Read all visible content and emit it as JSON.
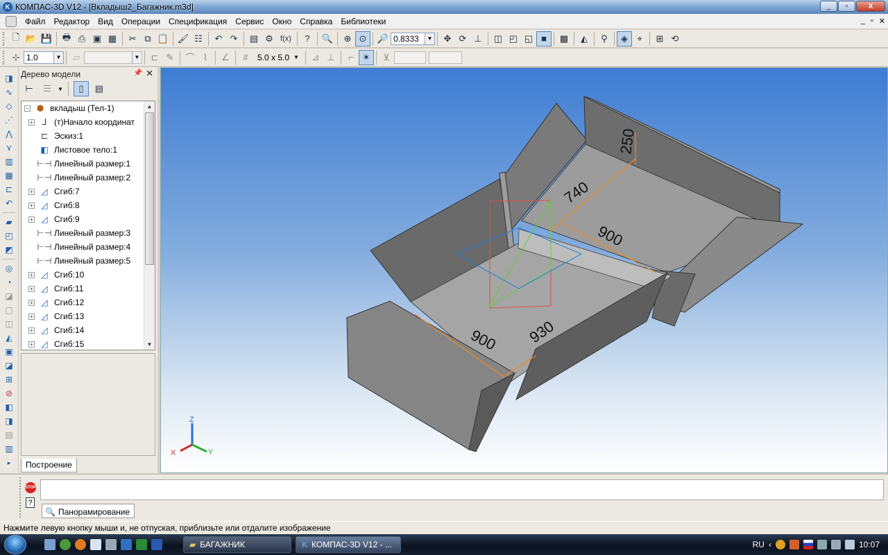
{
  "window": {
    "title": "КОМПАС-3D V12 - [Вкладыш2_Багажник.m3d]",
    "min_label": "_",
    "max_label": "▫",
    "close_label": "X"
  },
  "menu": {
    "items": [
      {
        "label": "Файл"
      },
      {
        "label": "Редактор"
      },
      {
        "label": "Вид"
      },
      {
        "label": "Операции"
      },
      {
        "label": "Спецификация"
      },
      {
        "label": "Сервис"
      },
      {
        "label": "Окно"
      },
      {
        "label": "Справка"
      },
      {
        "label": "Библиотеки"
      }
    ]
  },
  "toolbar1": {
    "zoom_value": "0.8333",
    "fx_label": "f(x)"
  },
  "toolbar2": {
    "step_value": "1.0",
    "grid_value": "5.0 x 5.0"
  },
  "tree": {
    "title": "Дерево модели",
    "rows": [
      {
        "label": "вкладыш (Тел-1)",
        "icon": "part-icon"
      },
      {
        "label": "(т)Начало координат",
        "icon": "origin-icon"
      },
      {
        "label": "Эскиз:1",
        "icon": "sketch-icon"
      },
      {
        "label": "Листовое тело:1",
        "icon": "sheet-body-icon"
      },
      {
        "label": "Линейный размер:1",
        "icon": "dimension-icon"
      },
      {
        "label": "Линейный размер:2",
        "icon": "dimension-icon"
      },
      {
        "label": "Сгиб:7",
        "icon": "bend-icon"
      },
      {
        "label": "Сгиб:8",
        "icon": "bend-icon"
      },
      {
        "label": "Сгиб:9",
        "icon": "bend-icon"
      },
      {
        "label": "Линейный размер:3",
        "icon": "dimension-icon"
      },
      {
        "label": "Линейный размер:4",
        "icon": "dimension-icon"
      },
      {
        "label": "Линейный размер:5",
        "icon": "dimension-icon"
      },
      {
        "label": "Сгиб:10",
        "icon": "bend-icon"
      },
      {
        "label": "Сгиб:11",
        "icon": "bend-icon"
      },
      {
        "label": "Сгиб:12",
        "icon": "bend-icon"
      },
      {
        "label": "Сгиб:13",
        "icon": "bend-icon"
      },
      {
        "label": "Сгиб:14",
        "icon": "bend-icon"
      },
      {
        "label": "Сгиб:15",
        "icon": "bend-icon"
      }
    ],
    "tab_label": "Построение"
  },
  "model": {
    "dimensions": [
      "250",
      "740",
      "900",
      "900",
      "930"
    ],
    "axes": {
      "x": "X",
      "y": "Y",
      "z": "Z"
    }
  },
  "properties": {
    "stop_label": "STOP",
    "help_label": "?",
    "tab_label": "Панорамирование"
  },
  "status": {
    "text": "Нажмите левую кнопку мыши и, не отпуская, приблизьте или отдалите изображение"
  },
  "taskbar": {
    "tasks": [
      {
        "label": "БАГАЖНИК"
      },
      {
        "label": "КОМПАС-3D V12 - ..."
      }
    ],
    "lang": "RU",
    "clock": "10:07"
  },
  "colors": {
    "viewport_top": "#3e7dd3",
    "viewport_bottom": "#ffffff",
    "dimension": "#f08a20",
    "model_face": "#8a8a8a"
  }
}
